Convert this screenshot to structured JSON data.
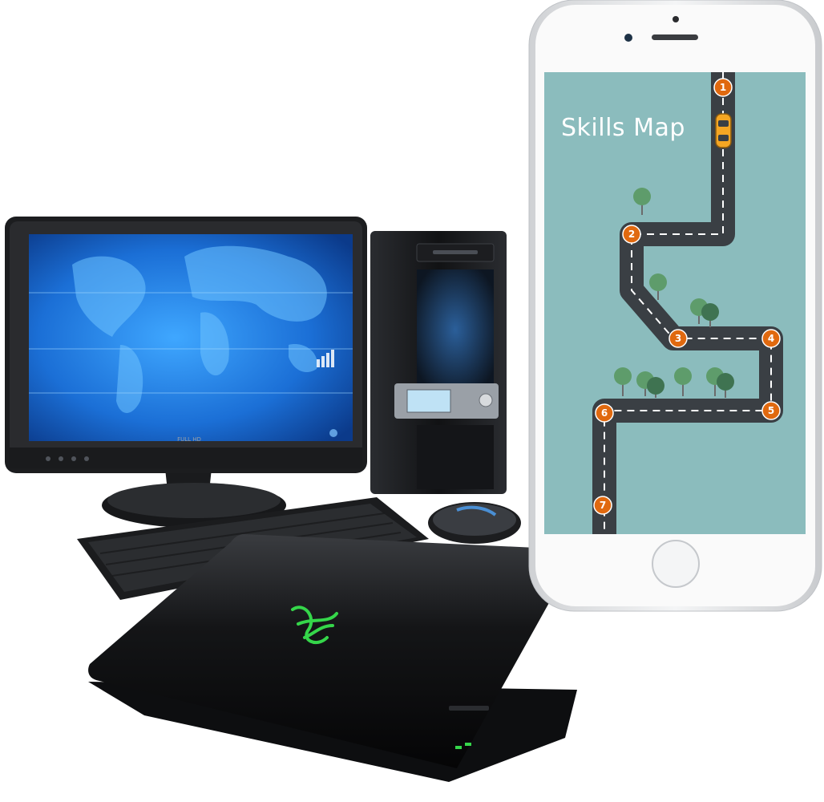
{
  "colors": {
    "background": "#ffffff",
    "phone_screen": "#8bbcbd",
    "road": "#3a3f44",
    "road_dash": "#ffffff",
    "stop_marker": "#e0690f",
    "tree_light": "#5e9c6b",
    "tree_dark": "#3f7351",
    "car": "#f5a623",
    "laptop_logo": "#35d64a",
    "monitor_screen": "#1b6fd6"
  },
  "phone": {
    "title": "Skills Map",
    "stops": [
      "1",
      "2",
      "3",
      "4",
      "5",
      "6",
      "7"
    ]
  },
  "monitor": {
    "brand_text": "FULL HD"
  },
  "icons": {
    "phone_home": "home-button-icon",
    "car": "car-icon",
    "laptop_logo": "razer-logo-icon"
  }
}
